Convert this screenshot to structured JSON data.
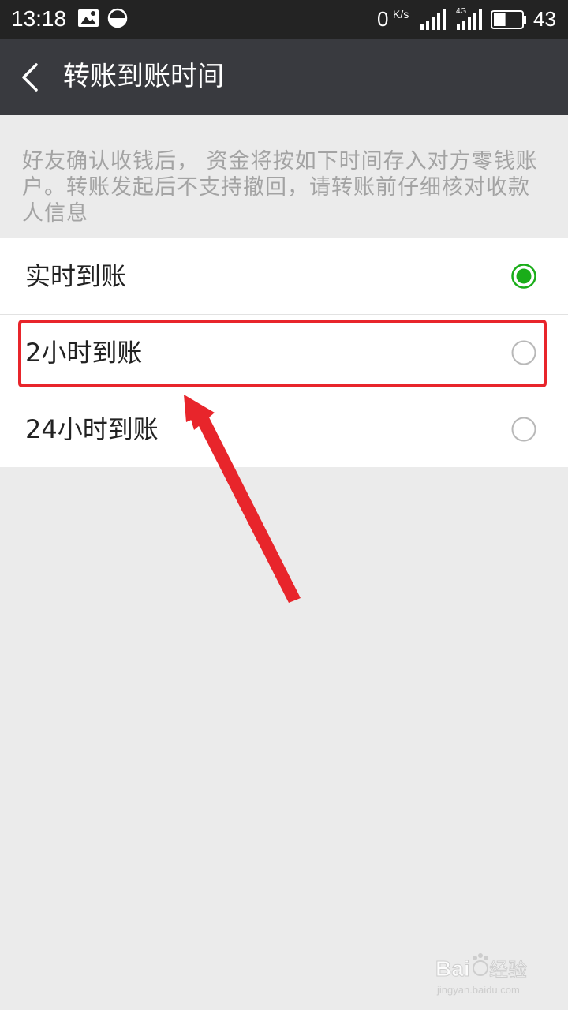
{
  "status_bar": {
    "time": "13:18",
    "speed_value": "0",
    "speed_unit": "K/s",
    "network_type": "4G",
    "battery_text": "43",
    "battery_level": 0.43
  },
  "header": {
    "title": "转账到账时间"
  },
  "description": "好友确认收钱后，  资金将按如下时间存入对方零钱账户。转账发起后不支持撤回，请转账前仔细核对收款人信息",
  "options": [
    {
      "label": "实时到账",
      "selected": true
    },
    {
      "label": "2小时到账",
      "selected": false
    },
    {
      "label": "24小时到账",
      "selected": false
    }
  ],
  "colors": {
    "header_bg": "#393a3f",
    "status_bg": "#232323",
    "accent_green": "#1aad19",
    "annotation_red": "#e8252b",
    "page_bg": "#ebebeb"
  },
  "icons": {
    "back": "chevron-left-icon",
    "image": "image-icon",
    "data_saver": "half-circle-icon",
    "signal": "signal-icon",
    "battery": "battery-icon"
  },
  "watermark": {
    "brand": "Bai",
    "brand_suffix": "经验",
    "url": "jingyan.baidu.com"
  }
}
